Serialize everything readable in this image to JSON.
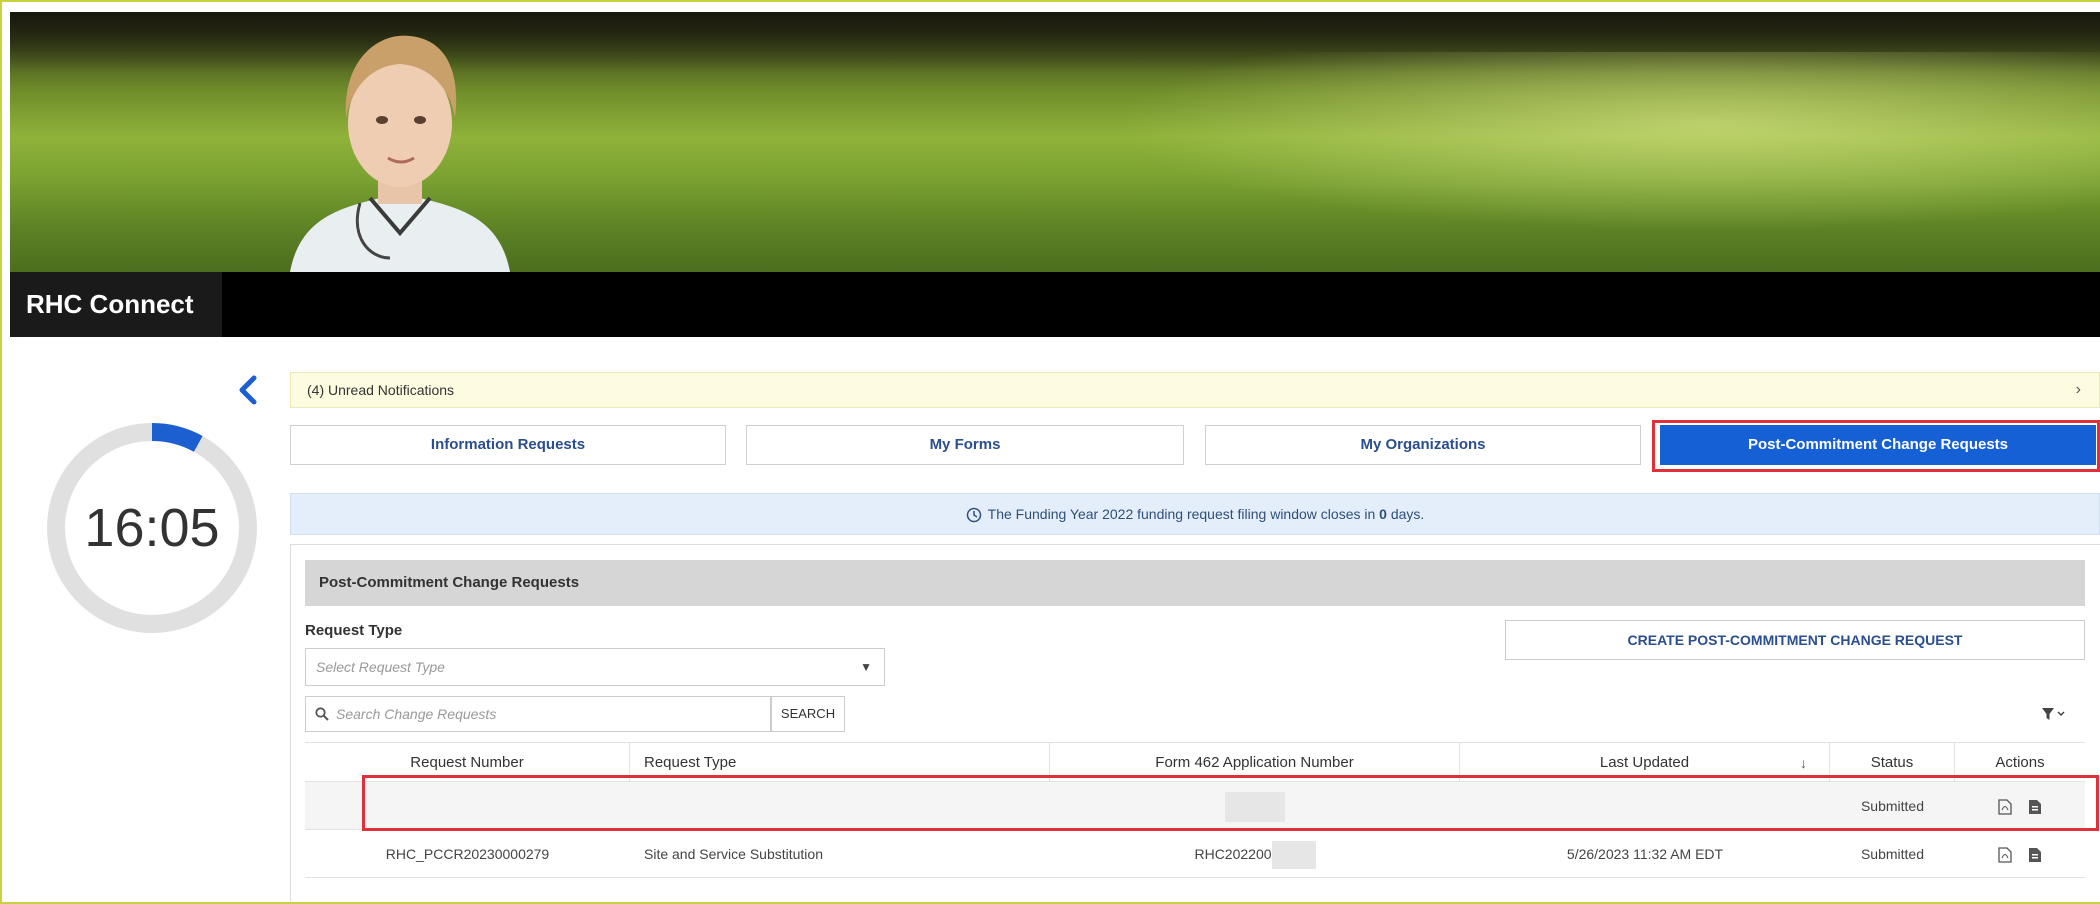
{
  "app": {
    "title": "RHC Connect"
  },
  "timer": {
    "display": "16:05",
    "progress": 0.08
  },
  "notifications": {
    "text": "(4) Unread Notifications"
  },
  "tabs": [
    {
      "label": "Information Requests",
      "active": false
    },
    {
      "label": "My Forms",
      "active": false
    },
    {
      "label": "My Organizations",
      "active": false
    },
    {
      "label": "Post-Commitment Change Requests",
      "active": true
    }
  ],
  "info_banner": {
    "text_before": "The Funding Year 2022 funding request filing window closes in ",
    "days": "0",
    "text_after": " days."
  },
  "panel": {
    "title": "Post-Commitment Change Requests",
    "request_type_label": "Request Type",
    "request_type_placeholder": "Select Request Type",
    "create_button": "CREATE POST-COMMITMENT CHANGE REQUEST",
    "search_placeholder": "Search Change Requests",
    "search_button": "SEARCH"
  },
  "table": {
    "headers": [
      "Request Number",
      "Request Type",
      "Form 462 Application Number",
      "Last Updated",
      "Status",
      "Actions"
    ],
    "rows": [
      {
        "request_number": "",
        "request_type": "",
        "form_462": "",
        "last_updated": "",
        "status": "Submitted"
      },
      {
        "request_number": "RHC_PCCR20230000279",
        "request_type": "Site and Service Substitution",
        "form_462": "RHC202200",
        "last_updated": "5/26/2023 11:32 AM EDT",
        "status": "Submitted"
      }
    ]
  },
  "colors": {
    "accent": "#1560d4",
    "highlight": "#e0303a",
    "brand_bar": "#000000",
    "notif_bg": "#fdfbe0",
    "info_bg": "#e4eefb"
  },
  "icons": [
    "back-chevron-icon",
    "right-chevron-icon",
    "clock-icon",
    "search-icon",
    "filter-icon",
    "pdf-icon",
    "document-icon"
  ]
}
